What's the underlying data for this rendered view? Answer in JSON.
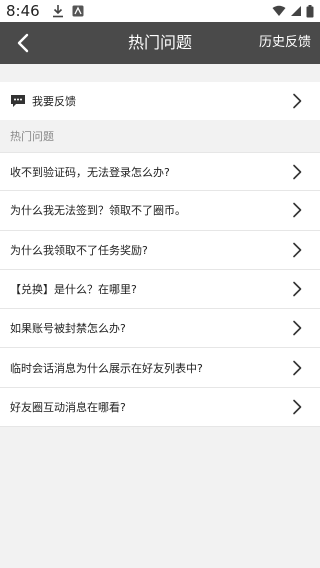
{
  "status_bar": {
    "time": "8:46"
  },
  "app_bar": {
    "title": "热门问题",
    "history_label": "历史反馈"
  },
  "feedback_row": {
    "label": "我要反馈"
  },
  "section_header": "热门问题",
  "faq_items": [
    "收不到验证码，无法登录怎么办?",
    "为什么我无法签到？领取不了圈币。",
    "为什么我领取不了任务奖励?",
    "【兑换】是什么？在哪里?",
    "如果账号被封禁怎么办?",
    "临时会话消息为什么展示在好友列表中?",
    "好友圈互动消息在哪看?"
  ],
  "colors": {
    "app_bar_bg": "#4a4a4a",
    "page_bg": "#f2f2f2"
  }
}
